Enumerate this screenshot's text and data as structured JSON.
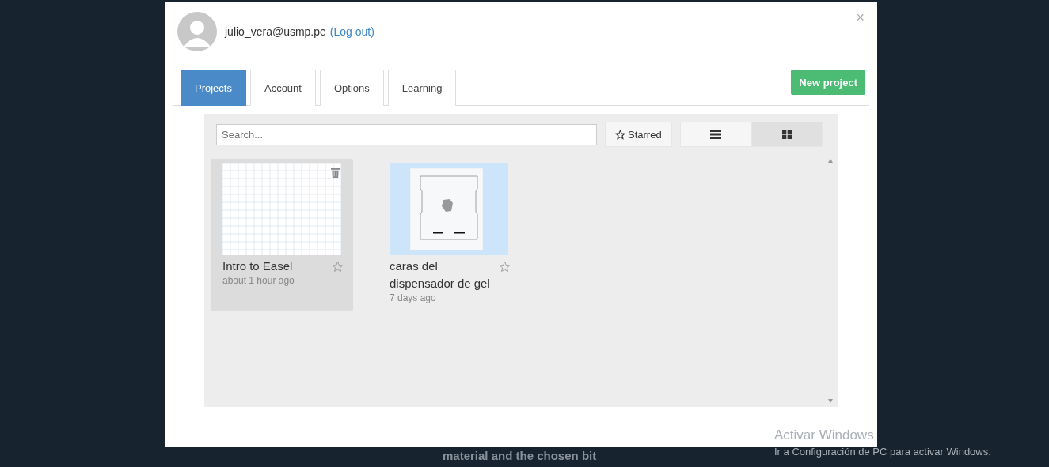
{
  "background_text": "material and the chosen bit",
  "user": {
    "email": "julio_vera@usmp.pe",
    "logout": "(Log out)"
  },
  "close": "×",
  "tabs": [
    {
      "label": "Projects",
      "selected": true
    },
    {
      "label": "Account",
      "selected": false
    },
    {
      "label": "Options",
      "selected": false
    },
    {
      "label": "Learning",
      "selected": false
    }
  ],
  "new_project": "New project",
  "search": {
    "placeholder": "Search..."
  },
  "starred_filter": {
    "label": "Starred"
  },
  "views": [
    {
      "kind": "list",
      "selected": false
    },
    {
      "kind": "grid",
      "selected": true
    }
  ],
  "projects": [
    {
      "title": "Intro to Easel",
      "time": "about 1 hour ago",
      "kind": "grid",
      "selected": true,
      "starred": false
    },
    {
      "title": "caras del dispensador de gel",
      "time": "7 days ago",
      "kind": "design",
      "selected": false,
      "starred": false
    }
  ],
  "os_notice": {
    "title": "Activar Windows",
    "text": "Ir a Configuración de PC para activar Windows."
  }
}
